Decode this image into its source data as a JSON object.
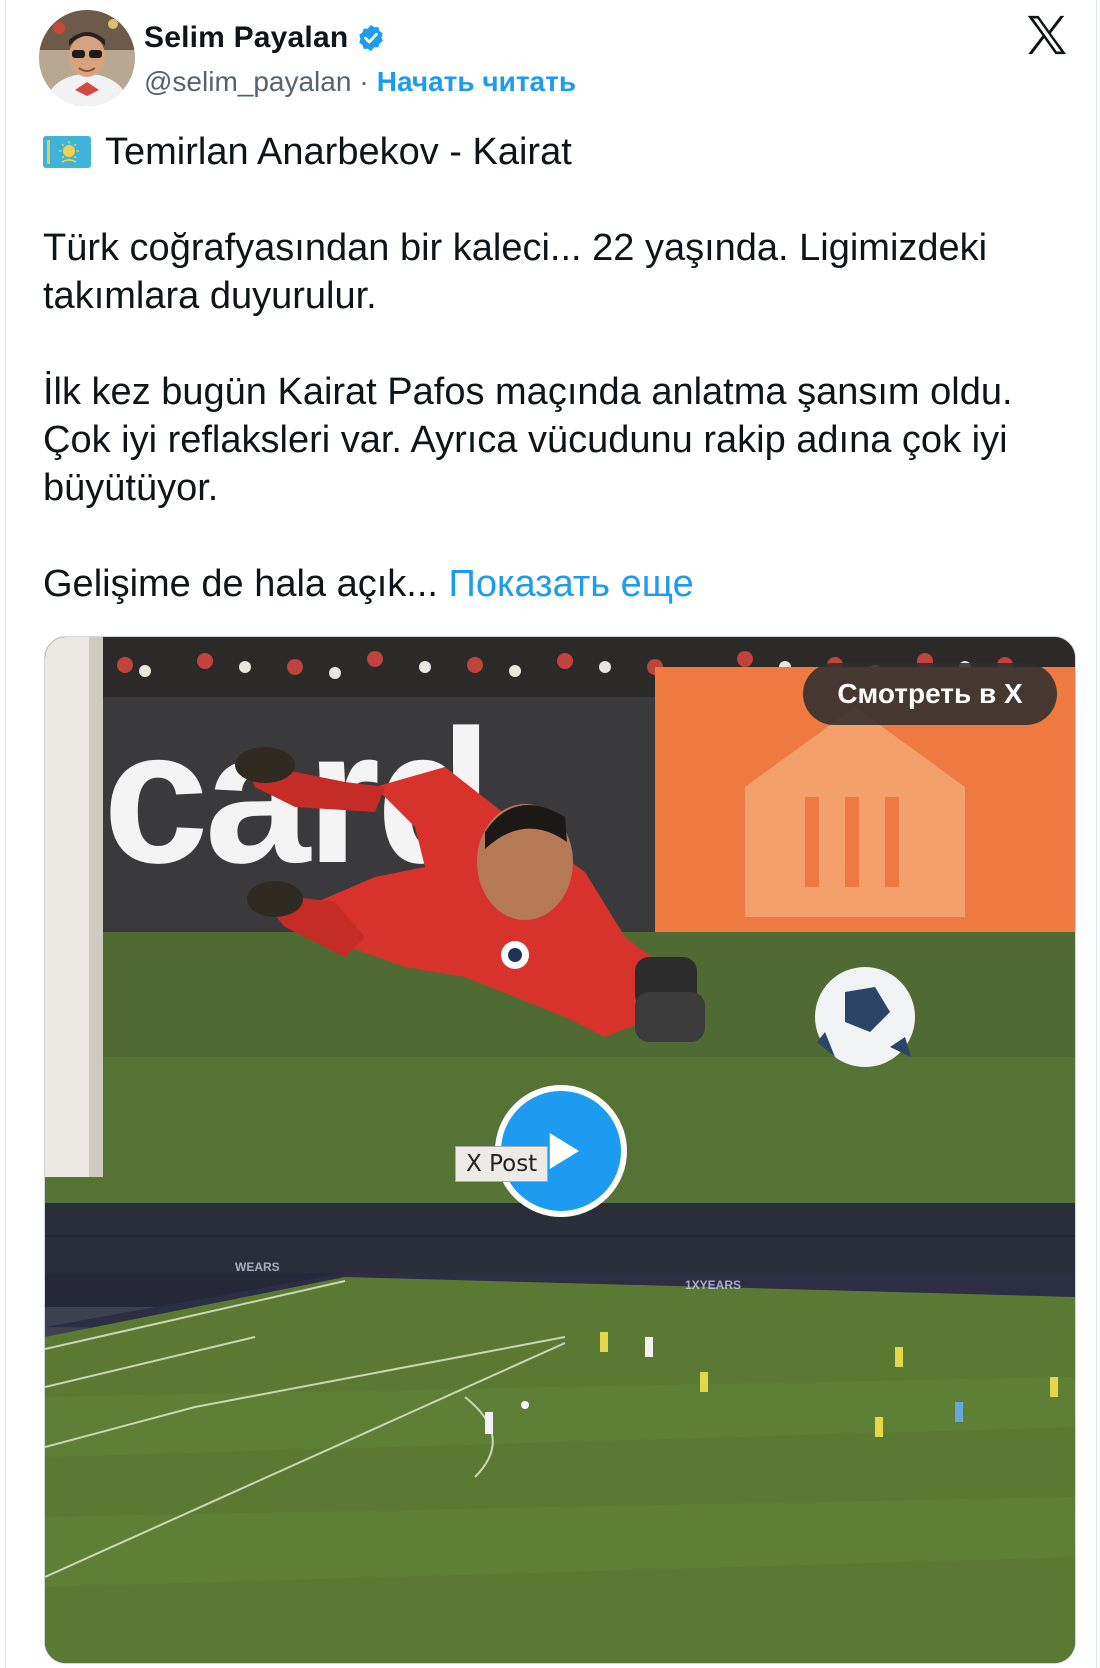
{
  "author": {
    "display_name": "Selim Payalan",
    "handle": "@selim_payalan",
    "separator": "·",
    "follow_label": "Начать читать",
    "verified": true
  },
  "tweet": {
    "title_line": "Temirlan Anarbekov - Kairat",
    "paragraphs": [
      "Türk coğrafyasından bir kaleci... 22 yaşında. Ligimizdeki takımlara duyurulur.",
      "İlk kez bugün Kairat Pafos maçında anlatma şansım oldu. Çok iyi reflaksleri var. Ayrıca vücudunu rakip adına çok iyi büyütüyor."
    ],
    "last_line": "Gelişime de hala açık...",
    "show_more_label": "Показать еще"
  },
  "media": {
    "watch_label": "Смотреть в X",
    "tooltip": "X Post",
    "banner_top_text": "card"
  },
  "icons": {
    "x_logo": "x-logo-icon",
    "verified": "verified-badge-icon",
    "flag": "kazakhstan-flag-icon",
    "play": "play-icon"
  },
  "colors": {
    "accent": "#1d9bf0",
    "text": "#0f1419",
    "muted": "#536471",
    "pitch": "#4a6b2e"
  }
}
